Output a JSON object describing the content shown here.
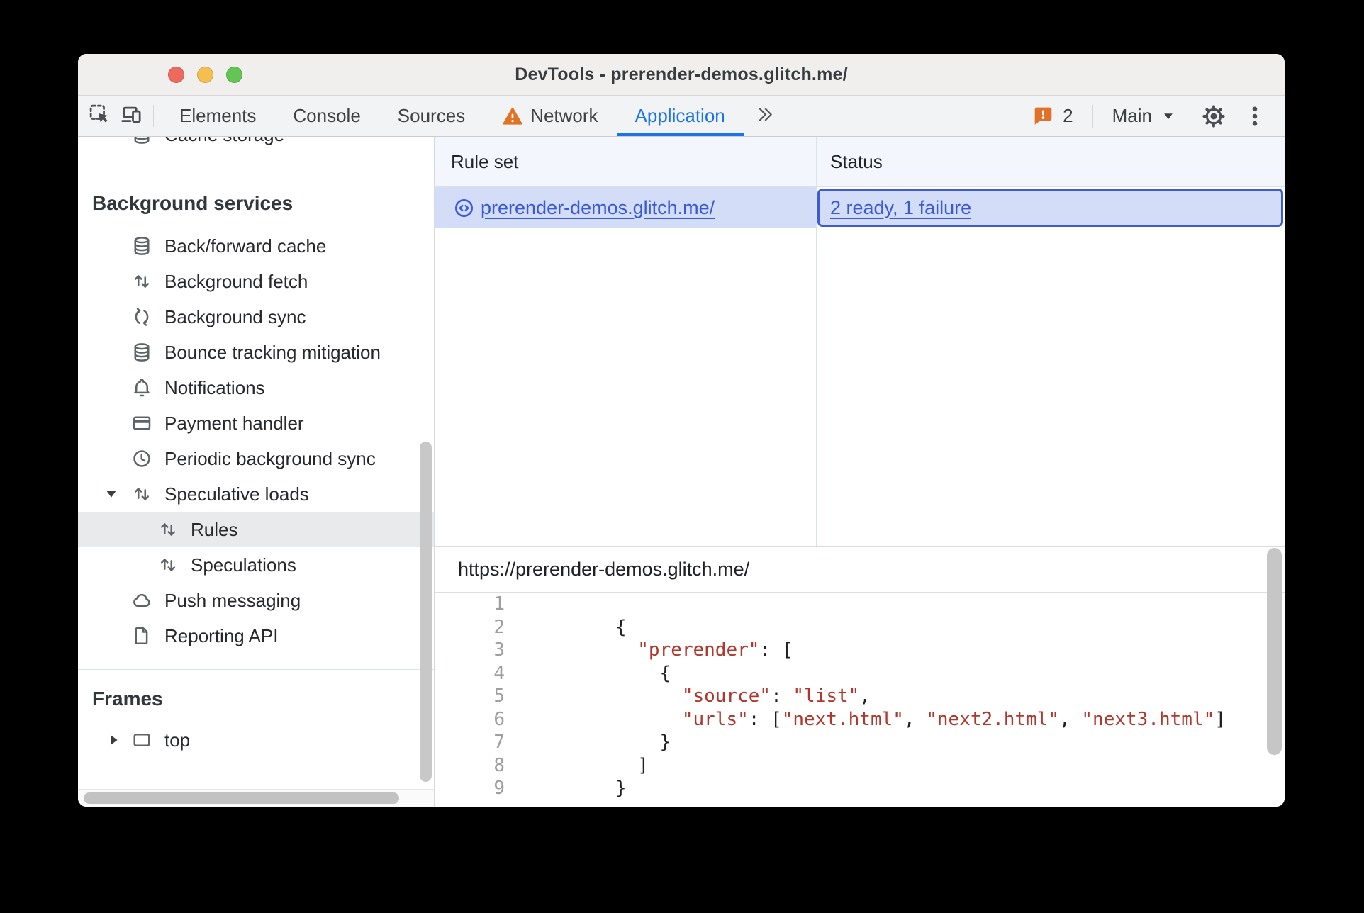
{
  "colors": {
    "tab_accent_blue": "#1a73e8",
    "link_blue": "#3a5ad5",
    "selected_row_blue": "#d3ddf8",
    "status_focus_border": "#3d5bd8",
    "warning_orange": "#dd7426",
    "issues_badge_orange": "#e2702b",
    "code_string_red": "#b0372c",
    "traffic_red": "#ee6a5f",
    "traffic_yellow": "#f5bf4f",
    "traffic_green": "#62c554"
  },
  "window": {
    "title": "DevTools - prerender-demos.glitch.me/"
  },
  "toolbar": {
    "inspect_icon": "inspect-cursor-icon",
    "device_icon": "device-toolbar-icon",
    "tabs": [
      {
        "label": "Elements"
      },
      {
        "label": "Console"
      },
      {
        "label": "Sources"
      },
      {
        "label": "Network",
        "warning_icon": "warning-triangle-icon"
      },
      {
        "label": "Application",
        "selected": true
      }
    ],
    "overflow_icon": "chevron-double-right-icon",
    "issues": {
      "icon": "issues-bubble-icon",
      "count": "2"
    },
    "target": {
      "label": "Main",
      "caret_icon": "chevron-down-icon"
    },
    "settings_icon": "gear-icon",
    "menu_icon": "kebab-menu-icon"
  },
  "sidebar": {
    "clipped_item": {
      "label": "Cache storage",
      "icon": "database-icon"
    },
    "sections": [
      {
        "title": "Background services",
        "items": [
          {
            "label": "Back/forward cache",
            "icon": "database-icon"
          },
          {
            "label": "Background fetch",
            "icon": "up-down-arrows-icon"
          },
          {
            "label": "Background sync",
            "icon": "sync-arrows-icon"
          },
          {
            "label": "Bounce tracking mitigation",
            "icon": "database-icon"
          },
          {
            "label": "Notifications",
            "icon": "bell-icon"
          },
          {
            "label": "Payment handler",
            "icon": "credit-card-icon"
          },
          {
            "label": "Periodic background sync",
            "icon": "clock-icon"
          },
          {
            "label": "Speculative loads",
            "icon": "up-down-arrows-icon",
            "expander": "down"
          },
          {
            "label": "Rules",
            "icon": "up-down-arrows-icon",
            "nested": true,
            "selected": true
          },
          {
            "label": "Speculations",
            "icon": "up-down-arrows-icon",
            "nested": true
          },
          {
            "label": "Push messaging",
            "icon": "cloud-icon"
          },
          {
            "label": "Reporting API",
            "icon": "document-icon"
          }
        ]
      },
      {
        "title": "Frames",
        "items": [
          {
            "label": "top",
            "icon": "frame-icon",
            "expander": "right"
          }
        ]
      }
    ]
  },
  "rules_panel": {
    "columns": [
      "Rule set",
      "Status"
    ],
    "rows": [
      {
        "rule_set": {
          "icon": "code-circle-icon",
          "label": "prerender-demos.glitch.me/"
        },
        "status": {
          "label": "2 ready, 1 failure",
          "selected": true
        }
      }
    ]
  },
  "source_panel": {
    "url": "https://prerender-demos.glitch.me/",
    "code_lines": [
      {
        "n": "1",
        "segments": []
      },
      {
        "n": "2",
        "segments": [
          {
            "t": "      {"
          }
        ]
      },
      {
        "n": "3",
        "segments": [
          {
            "t": "        "
          },
          {
            "t": "\"prerender\"",
            "c": "string"
          },
          {
            "t": ": ["
          }
        ]
      },
      {
        "n": "4",
        "segments": [
          {
            "t": "          {"
          }
        ]
      },
      {
        "n": "5",
        "segments": [
          {
            "t": "            "
          },
          {
            "t": "\"source\"",
            "c": "string"
          },
          {
            "t": ": "
          },
          {
            "t": "\"list\"",
            "c": "string"
          },
          {
            "t": ","
          }
        ]
      },
      {
        "n": "6",
        "segments": [
          {
            "t": "            "
          },
          {
            "t": "\"urls\"",
            "c": "string"
          },
          {
            "t": ": ["
          },
          {
            "t": "\"next.html\"",
            "c": "string"
          },
          {
            "t": ", "
          },
          {
            "t": "\"next2.html\"",
            "c": "string"
          },
          {
            "t": ", "
          },
          {
            "t": "\"next3.html\"",
            "c": "string"
          },
          {
            "t": "]"
          }
        ]
      },
      {
        "n": "7",
        "segments": [
          {
            "t": "          }"
          }
        ]
      },
      {
        "n": "8",
        "segments": [
          {
            "t": "        ]"
          }
        ]
      },
      {
        "n": "9",
        "segments": [
          {
            "t": "      }"
          }
        ]
      }
    ]
  }
}
